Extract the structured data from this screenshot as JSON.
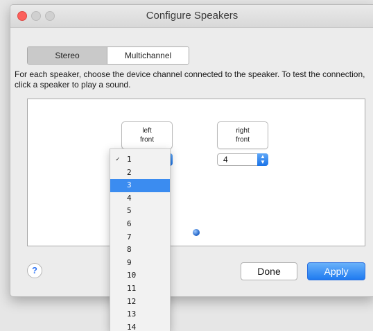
{
  "window": {
    "title": "Configure Speakers"
  },
  "segments": [
    "Stereo",
    "Multichannel"
  ],
  "instructions": "For each speaker, choose the device channel connected to the speaker. To test the connection, click a speaker to play a sound.",
  "speakers": {
    "left": {
      "line1": "left",
      "line2": "front",
      "channel": "1"
    },
    "right": {
      "line1": "right",
      "line2": "front",
      "channel": "4"
    }
  },
  "buttons": {
    "help": "?",
    "done": "Done",
    "apply": "Apply"
  },
  "menu": {
    "checkmark": "✓",
    "items": [
      "1",
      "2",
      "3",
      "4",
      "5",
      "6",
      "7",
      "8",
      "9",
      "10",
      "11",
      "12",
      "13",
      "14"
    ],
    "checked": "1",
    "highlighted": "3"
  },
  "colors": {
    "accent": "#3b8cf0",
    "close": "#fc605b"
  }
}
